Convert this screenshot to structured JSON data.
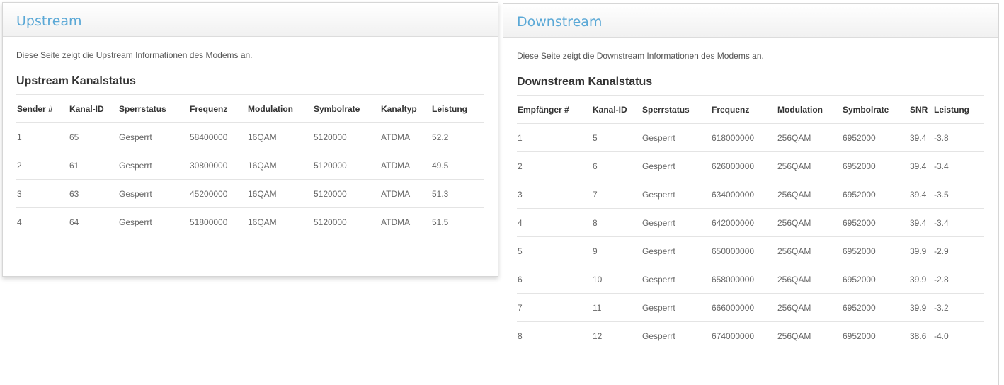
{
  "upstream": {
    "title": "Upstream",
    "intro": "Diese Seite zeigt die Upstream Informationen des Modems an.",
    "section_title": "Upstream Kanalstatus",
    "columns": [
      "Sender #",
      "Kanal-ID",
      "Sperrstatus",
      "Frequenz",
      "Modulation",
      "Symbolrate",
      "Kanaltyp",
      "Leistung"
    ],
    "rows": [
      [
        "1",
        "65",
        "Gesperrt",
        "58400000",
        "16QAM",
        "5120000",
        "ATDMA",
        "52.2"
      ],
      [
        "2",
        "61",
        "Gesperrt",
        "30800000",
        "16QAM",
        "5120000",
        "ATDMA",
        "49.5"
      ],
      [
        "3",
        "63",
        "Gesperrt",
        "45200000",
        "16QAM",
        "5120000",
        "ATDMA",
        "51.3"
      ],
      [
        "4",
        "64",
        "Gesperrt",
        "51800000",
        "16QAM",
        "5120000",
        "ATDMA",
        "51.5"
      ]
    ]
  },
  "downstream": {
    "title": "Downstream",
    "intro": "Diese Seite zeigt die Downstream Informationen des Modems an.",
    "section_title": "Downstream Kanalstatus",
    "columns": [
      "Empfänger #",
      "Kanal-ID",
      "Sperrstatus",
      "Frequenz",
      "Modulation",
      "Symbolrate",
      "SNR",
      "Leistung"
    ],
    "rows": [
      [
        "1",
        "5",
        "Gesperrt",
        "618000000",
        "256QAM",
        "6952000",
        "39.4",
        "-3.8"
      ],
      [
        "2",
        "6",
        "Gesperrt",
        "626000000",
        "256QAM",
        "6952000",
        "39.4",
        "-3.4"
      ],
      [
        "3",
        "7",
        "Gesperrt",
        "634000000",
        "256QAM",
        "6952000",
        "39.4",
        "-3.5"
      ],
      [
        "4",
        "8",
        "Gesperrt",
        "642000000",
        "256QAM",
        "6952000",
        "39.4",
        "-3.4"
      ],
      [
        "5",
        "9",
        "Gesperrt",
        "650000000",
        "256QAM",
        "6952000",
        "39.9",
        "-2.9"
      ],
      [
        "6",
        "10",
        "Gesperrt",
        "658000000",
        "256QAM",
        "6952000",
        "39.9",
        "-2.8"
      ],
      [
        "7",
        "11",
        "Gesperrt",
        "666000000",
        "256QAM",
        "6952000",
        "39.9",
        "-3.2"
      ],
      [
        "8",
        "12",
        "Gesperrt",
        "674000000",
        "256QAM",
        "6952000",
        "38.6",
        "-4.0"
      ]
    ]
  },
  "colors": {
    "title_accent": "#5aa8d6",
    "border": "#d6d6d6",
    "row_divider": "#e4e4e4"
  }
}
